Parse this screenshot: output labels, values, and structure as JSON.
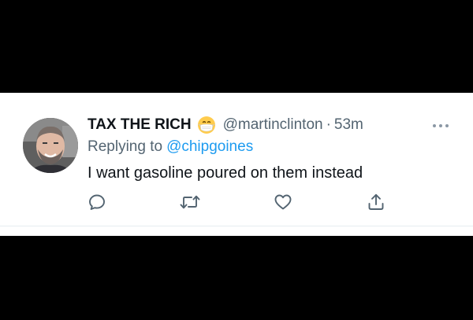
{
  "tweet": {
    "display_name": "TAX THE RICH",
    "name_emoji": "face-with-medical-mask-emoji",
    "handle": "@martinclinton",
    "separator": "·",
    "timestamp": "53m",
    "replying_prefix": "Replying to",
    "replying_to": "@chipgoines",
    "text": "I want gasoline poured on them instead"
  },
  "actions": [
    {
      "name": "reply",
      "icon": "speech-bubble-icon"
    },
    {
      "name": "retweet",
      "icon": "retweet-icon"
    },
    {
      "name": "like",
      "icon": "heart-icon"
    },
    {
      "name": "share",
      "icon": "share-icon"
    }
  ],
  "colors": {
    "text_primary": "#0f1419",
    "text_secondary": "#536471",
    "link": "#1d9bf0",
    "background": "#ffffff",
    "letterbox": "#000000"
  }
}
